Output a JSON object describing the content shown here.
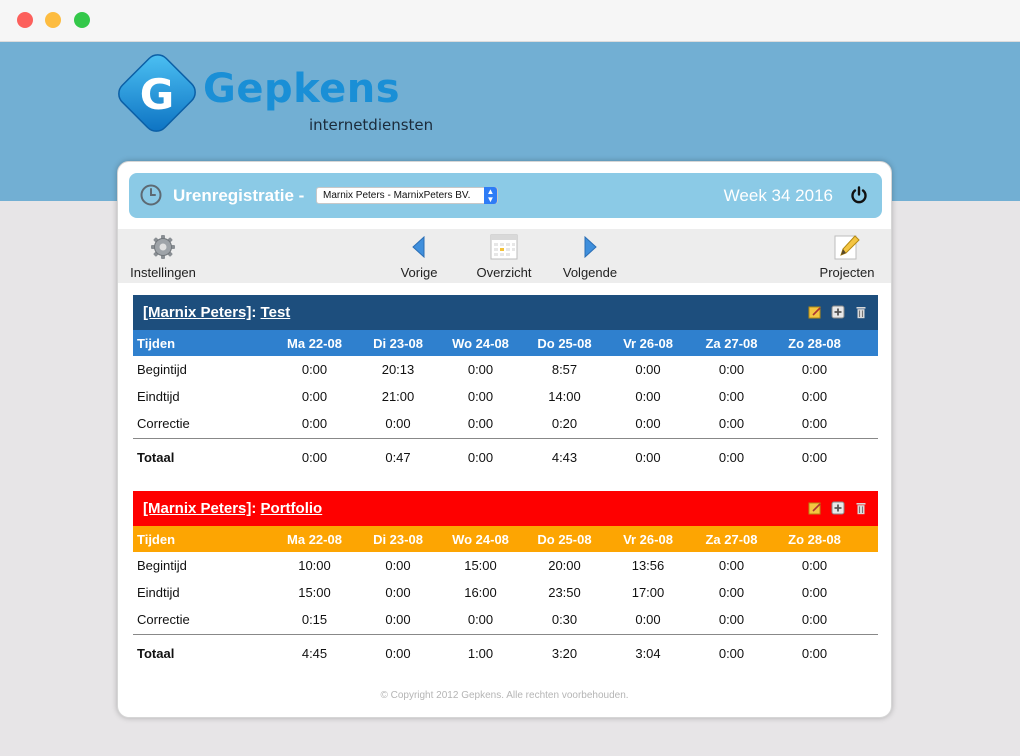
{
  "brand": {
    "name": "Gepkens",
    "sub": "internetdiensten",
    "logo_letter": "G"
  },
  "header": {
    "title": "Urenregistratie -",
    "user_select": "Marnix Peters - MarnixPeters BV.",
    "week": "Week 34 2016"
  },
  "toolbar": {
    "settings": "Instellingen",
    "prev": "Vorige",
    "overview": "Overzicht",
    "next": "Volgende",
    "projects": "Projecten"
  },
  "columns": [
    "Tijden",
    "Ma 22-08",
    "Di 23-08",
    "Wo 24-08",
    "Do 25-08",
    "Vr 26-08",
    "Za 27-08",
    "Zo 28-08"
  ],
  "projects": [
    {
      "user": "[Marnix Peters]",
      "sep": ":",
      "name": "Test",
      "head_color": "#1d4e7d",
      "bar_color": "#2f80ce",
      "rows": [
        {
          "label": "Begintijd",
          "values": [
            "0:00",
            "20:13",
            "0:00",
            "8:57",
            "0:00",
            "0:00",
            "0:00"
          ]
        },
        {
          "label": "Eindtijd",
          "values": [
            "0:00",
            "21:00",
            "0:00",
            "14:00",
            "0:00",
            "0:00",
            "0:00"
          ]
        },
        {
          "label": "Correctie",
          "values": [
            "0:00",
            "0:00",
            "0:00",
            "0:20",
            "0:00",
            "0:00",
            "0:00"
          ]
        }
      ],
      "total": {
        "label": "Totaal",
        "values": [
          "0:00",
          "0:47",
          "0:00",
          "4:43",
          "0:00",
          "0:00",
          "0:00"
        ]
      }
    },
    {
      "user": "[Marnix Peters]",
      "sep": ":",
      "name": "Portfolio",
      "head_color": "#fe0000",
      "bar_color": "#fda502",
      "rows": [
        {
          "label": "Begintijd",
          "values": [
            "10:00",
            "0:00",
            "15:00",
            "20:00",
            "13:56",
            "0:00",
            "0:00"
          ]
        },
        {
          "label": "Eindtijd",
          "values": [
            "15:00",
            "0:00",
            "16:00",
            "23:50",
            "17:00",
            "0:00",
            "0:00"
          ]
        },
        {
          "label": "Correctie",
          "values": [
            "0:15",
            "0:00",
            "0:00",
            "0:30",
            "0:00",
            "0:00",
            "0:00"
          ]
        }
      ],
      "total": {
        "label": "Totaal",
        "values": [
          "4:45",
          "0:00",
          "1:00",
          "3:20",
          "3:04",
          "0:00",
          "0:00"
        ]
      }
    }
  ],
  "footer": {
    "copyright": "© Copyright 2012 Gepkens. Alle rechten voorbehouden."
  },
  "colors": {
    "banner": "#72afd3",
    "titlebar": "#8bcae6",
    "accent": "#1a8fd6"
  }
}
